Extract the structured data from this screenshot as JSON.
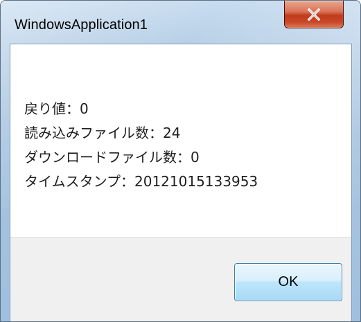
{
  "window": {
    "title": "WindowsApplication1"
  },
  "icons": {
    "close": "close-icon"
  },
  "message": {
    "lines": [
      "戻り値：0",
      "読み込みファイル数：24",
      "ダウンロードファイル数：0",
      "タイムスタンプ：20121015133953"
    ]
  },
  "buttons": {
    "ok_label": "OK"
  },
  "colors": {
    "close_button": "#c13a1b",
    "ok_border": "#3c7fb1",
    "button_area": "#f0f0f0",
    "frame": "#a8c4e0"
  }
}
